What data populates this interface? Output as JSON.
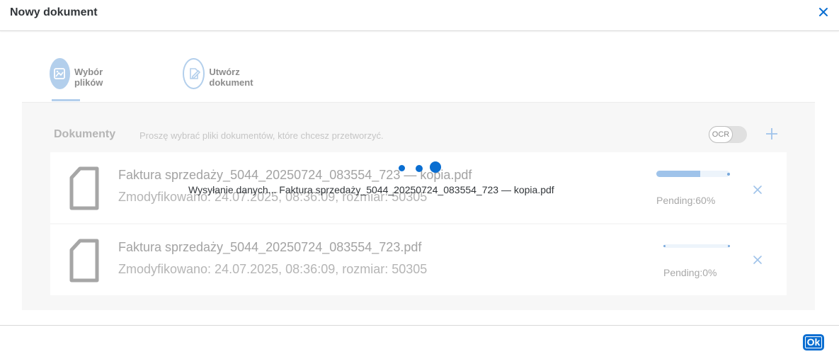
{
  "dialog": {
    "title": "Nowy dokument",
    "close_icon": "close-icon"
  },
  "wizard": {
    "steps": [
      {
        "label": "Wybór plików",
        "icon": "image-upload-icon",
        "active": true
      },
      {
        "label": "Utwórz dokument",
        "icon": "edit-document-icon",
        "active": false
      }
    ]
  },
  "documents": {
    "title": "Dokumenty",
    "subtitle": "Proszę wybrać pliki dokumentów, które chcesz przetworzyć.",
    "ocr_label": "OCR",
    "ocr_enabled": false,
    "add_icon": "add-icon"
  },
  "files": [
    {
      "name": "Faktura sprzedaży_5044_20250724_083554_723 — kopia.pdf",
      "meta": "Zmodyfikowano: 24.07.2025, 08:36:09, rozmiar: 50305",
      "progress": 60,
      "status": "Pending:60%"
    },
    {
      "name": "Faktura sprzedaży_5044_20250724_083554_723.pdf",
      "meta": "Zmodyfikowano: 24.07.2025, 08:36:09, rozmiar: 50305",
      "progress": 0,
      "status": "Pending:0%"
    }
  ],
  "busy": {
    "text": "Wysyłanie danych... Faktura sprzedaży_5044_20250724_083554_723 — kopia.pdf"
  },
  "footer": {
    "ok_label": "Ok"
  },
  "colors": {
    "accent": "#0a6ed1",
    "progress_fill": "#9fc3ea",
    "step_circle": "#b3cfec"
  }
}
